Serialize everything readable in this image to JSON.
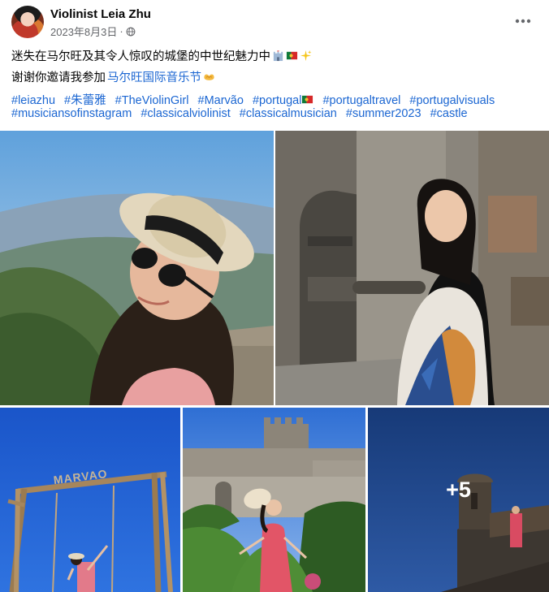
{
  "post": {
    "author": "Violinist Leia Zhu",
    "date": "2023年8月3日",
    "privacy_icon": "globe-icon",
    "more_icon": "more-horizontal-icon"
  },
  "caption": {
    "line1_text": "迷失在马尔旺及其令人惊叹的城堡的中世纪魅力中",
    "line1_emojis": [
      "castle-emoji",
      "portugal-flag-emoji",
      "sparkles-emoji"
    ],
    "line2_text": "谢谢你邀请我参加",
    "line2_link": "马尔旺国际音乐节",
    "line2_emoji": "heart-hands-emoji"
  },
  "hashtags": {
    "row1": [
      "#leiazhu",
      "#朱蕾雅",
      "#TheViolinGirl",
      "#Marvão",
      "#portugal",
      "#portugaltravel",
      "#portugalvisuals"
    ],
    "row2": [
      "#musiciansofinstagram",
      "#classicalviolinist",
      "#classicalmusician",
      "#summer2023",
      "#castle"
    ]
  },
  "photos": {
    "more_count": "+5",
    "sign_text": "MARVAO"
  },
  "colors": {
    "link": "#1b66d2",
    "secondary_text": "#65676b",
    "primary_text": "#050505"
  }
}
